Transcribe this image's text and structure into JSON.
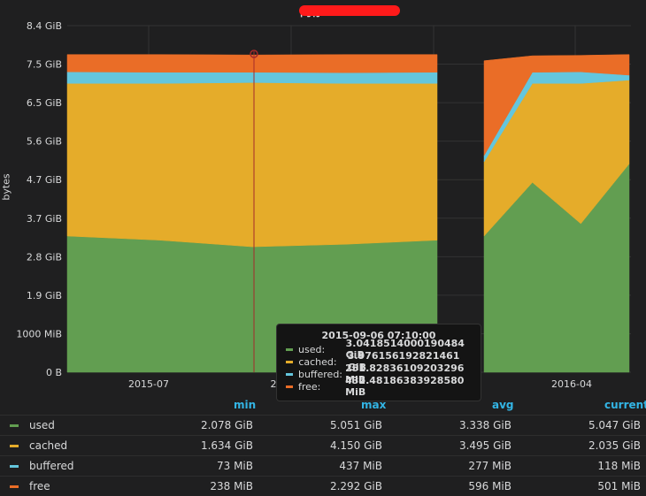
{
  "panel": {
    "title": "内存 <<"
  },
  "chart_data": {
    "type": "area",
    "stacked": true,
    "ylabel": "bytes",
    "x_ticks": [
      "2015-07",
      "2",
      "2016-04"
    ],
    "y_ticks": [
      "0 B",
      "1000 MiB",
      "1.9 GiB",
      "2.8 GiB",
      "3.7 GiB",
      "4.7 GiB",
      "5.6 GiB",
      "6.5 GiB",
      "7.5 GiB",
      "8.4 GiB"
    ],
    "ylim_gib": [
      0,
      8.4
    ],
    "segments": [
      {
        "name": "segment-1",
        "x": [
          "2015-05",
          "2015-07",
          "2015-09",
          "2015-11",
          "2016-01"
        ],
        "series": [
          {
            "name": "used",
            "values": [
              3.3,
              3.2,
              3.04,
              3.1,
              3.2
            ]
          },
          {
            "name": "cached",
            "values": [
              3.7,
              3.8,
              3.98,
              3.9,
              3.8
            ]
          },
          {
            "name": "buffered",
            "values": [
              0.28,
              0.27,
              0.25,
              0.26,
              0.27
            ]
          },
          {
            "name": "free",
            "values": [
              0.42,
              0.43,
              0.42,
              0.44,
              0.43
            ]
          }
        ]
      },
      {
        "name": "segment-2",
        "x": [
          "2016-02",
          "2016-03",
          "2016-04",
          "2016-05"
        ],
        "series": [
          {
            "name": "used",
            "values": [
              3.3,
              4.6,
              3.6,
              5.05
            ]
          },
          {
            "name": "cached",
            "values": [
              1.8,
              2.4,
              3.4,
              2.03
            ]
          },
          {
            "name": "buffered",
            "values": [
              0.15,
              0.27,
              0.28,
              0.12
            ]
          },
          {
            "name": "free",
            "values": [
              2.3,
              0.4,
              0.4,
              0.5
            ]
          }
        ]
      }
    ],
    "cursor_time": "2015-09-06 07:10:00"
  },
  "tooltip": {
    "time": "2015-09-06 07:10:00",
    "rows": [
      {
        "name": "used:",
        "value": "3.0418514000190484 GiB"
      },
      {
        "name": "cached:",
        "value": "3.976156192821461 GiB"
      },
      {
        "name": "buffered:",
        "value": "251.82836109203296 MiB"
      },
      {
        "name": "free:",
        "value": "432.48186383928580 MiB"
      }
    ]
  },
  "legend": {
    "headers": {
      "min": "min",
      "max": "max",
      "avg": "avg",
      "current": "current"
    },
    "rows": [
      {
        "name": "used",
        "min": "2.078 GiB",
        "max": "5.051 GiB",
        "avg": "3.338 GiB",
        "current": "5.047 GiB"
      },
      {
        "name": "cached",
        "min": "1.634 GiB",
        "max": "4.150 GiB",
        "avg": "3.495 GiB",
        "current": "2.035 GiB"
      },
      {
        "name": "buffered",
        "min": "73 MiB",
        "max": "437 MiB",
        "avg": "277 MiB",
        "current": "118 MiB"
      },
      {
        "name": "free",
        "min": "238 MiB",
        "max": "2.292 GiB",
        "avg": "596 MiB",
        "current": "501 MiB"
      }
    ]
  },
  "colors": {
    "used": "#629e51",
    "cached": "#e5ac2a",
    "buffered": "#64c6dd",
    "free": "#ea6d27",
    "accent": "#33b5e5"
  }
}
